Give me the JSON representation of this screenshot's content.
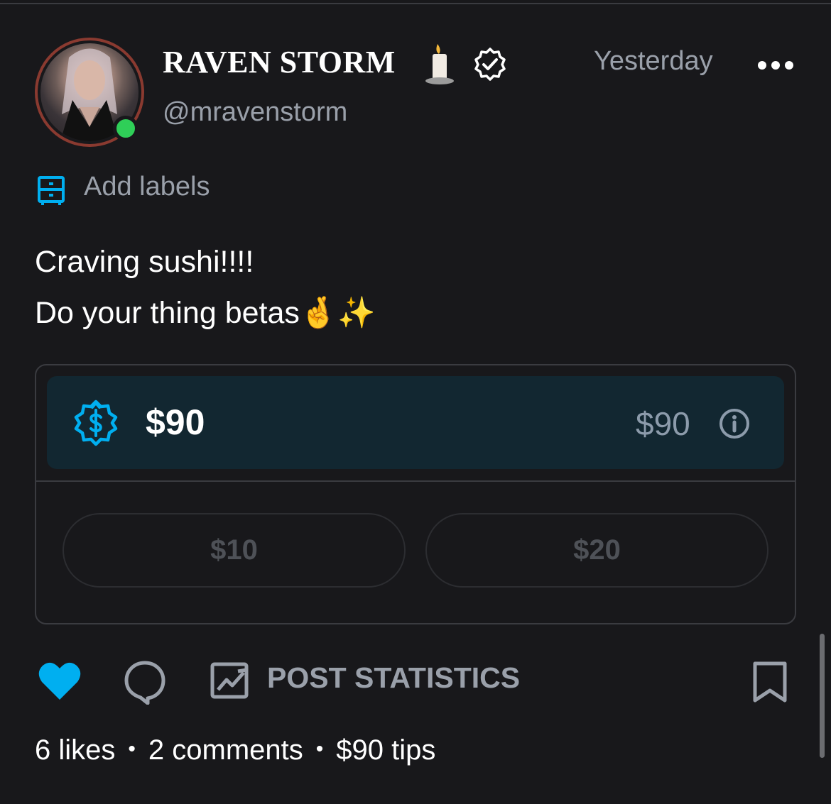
{
  "author": {
    "name": "RAVEN STORM",
    "name_emoji": "candle",
    "verified_icon": "verified-badge-icon",
    "handle": "@mravenstorm",
    "online": true
  },
  "post": {
    "time": "Yesterday",
    "add_labels": "Add labels",
    "line1": "Craving sushi!!!!",
    "line2": "Do your thing betas",
    "line2_emoji": "🤞✨"
  },
  "tip": {
    "amount": "$90",
    "right_amount": "$90",
    "options": [
      "$10",
      "$20"
    ]
  },
  "actions": {
    "post_statistics": "POST STATISTICS",
    "liked": true
  },
  "stats": {
    "likes": "6 likes",
    "comments": "2 comments",
    "tips": "$90 tips",
    "separator": "•"
  },
  "colors": {
    "background": "#18181b",
    "accent": "#00aff0",
    "muted": "#9aa0aa",
    "online": "#2fcf58"
  }
}
